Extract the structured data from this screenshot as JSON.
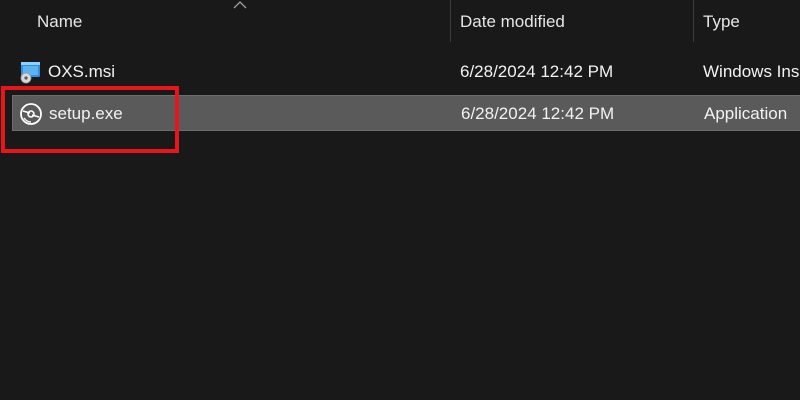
{
  "columns": {
    "name": "Name",
    "date_modified": "Date modified",
    "type": "Type"
  },
  "sort": {
    "column": "name",
    "icon": "sort-ascending-caret-icon"
  },
  "files": [
    {
      "name": "OXS.msi",
      "date_modified": "6/28/2024 12:42 PM",
      "type": "Windows Ins",
      "icon": "msi-installer-icon",
      "selected": false
    },
    {
      "name": "setup.exe",
      "date_modified": "6/28/2024 12:42 PM",
      "type": "Application",
      "icon": "setup-disc-icon",
      "selected": true
    }
  ],
  "colors": {
    "background": "#191919",
    "selected_row": "#5a5a5a",
    "highlight": "#e8161b",
    "text": "#f2f2f2"
  }
}
